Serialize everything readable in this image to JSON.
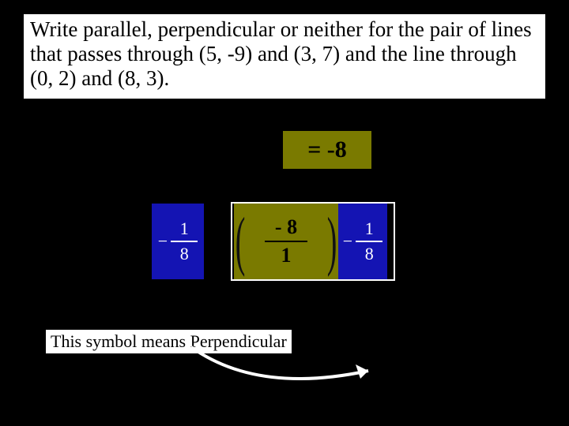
{
  "question": {
    "text": "Write parallel, perpendicular or neither for the pair of lines that passes through (5, -9) and (3, 7) and the line through (0, 2) and (8, 3)."
  },
  "eq_top": {
    "text": "= -8"
  },
  "frac_left": {
    "sign": "−",
    "num": "1",
    "den": "8"
  },
  "frac_mid": {
    "num": "- 8",
    "den": "1"
  },
  "frac_right": {
    "sign": "−",
    "num": "1",
    "den": "8"
  },
  "caption": {
    "text": "This symbol means Perpendicular"
  }
}
